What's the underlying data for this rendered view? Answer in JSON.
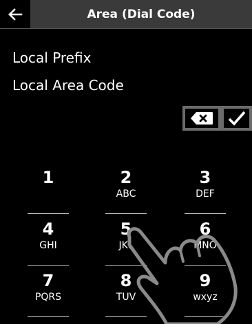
{
  "header": {
    "title": "Area (Dial Code)",
    "back_icon": "arrow-left-icon"
  },
  "fields": [
    {
      "label": "Local Prefix"
    },
    {
      "label": "Local Area Code"
    }
  ],
  "actions": {
    "delete_icon": "backspace-icon",
    "confirm_icon": "checkmark-icon"
  },
  "keypad": [
    {
      "digit": "1",
      "letters": ""
    },
    {
      "digit": "2",
      "letters": "ABC"
    },
    {
      "digit": "3",
      "letters": "DEF"
    },
    {
      "digit": "4",
      "letters": "GHI"
    },
    {
      "digit": "5",
      "letters": "JKL"
    },
    {
      "digit": "6",
      "letters": "MNO"
    },
    {
      "digit": "7",
      "letters": "PQRS"
    },
    {
      "digit": "8",
      "letters": "TUV"
    },
    {
      "digit": "9",
      "letters": "wxyz"
    }
  ],
  "colors": {
    "titlebar": "#3a3a3a",
    "action_border": "#6b6b6b"
  }
}
